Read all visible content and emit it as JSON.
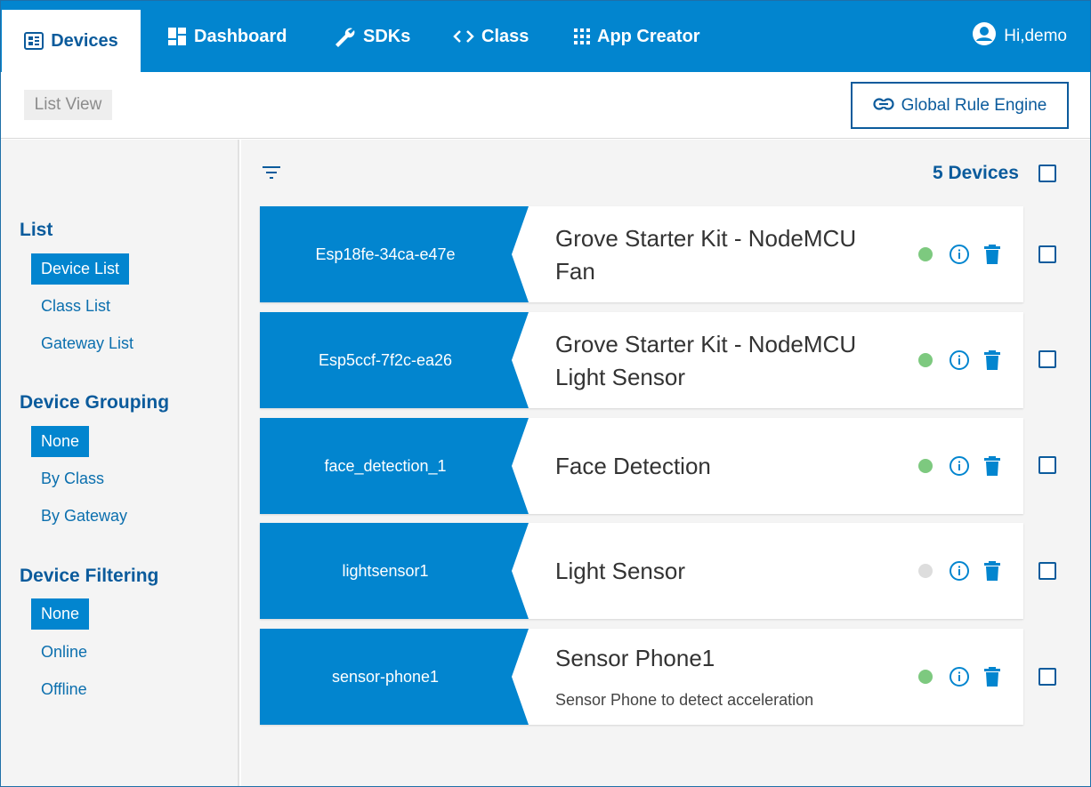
{
  "nav": {
    "active": {
      "label": "Devices",
      "icon": "devices-icon"
    },
    "items": [
      {
        "label": "Dashboard",
        "icon": "dashboard-icon"
      },
      {
        "label": "SDKs",
        "icon": "wrench-icon"
      },
      {
        "label": "Class",
        "icon": "code-icon"
      },
      {
        "label": "App Creator",
        "icon": "grid-icon"
      }
    ],
    "user": {
      "label": "Hi,demo",
      "icon": "account-circle-icon"
    }
  },
  "subheader": {
    "list_view": "List View",
    "global_rule_engine": "Global Rule Engine"
  },
  "sidebar": {
    "list": {
      "heading": "List",
      "items": [
        "Device List",
        "Class List",
        "Gateway List"
      ],
      "active": "Device List"
    },
    "grouping": {
      "heading": "Device Grouping",
      "items": [
        "None",
        "By Class",
        "By Gateway"
      ],
      "active": "None"
    },
    "filtering": {
      "heading": "Device Filtering",
      "items": [
        "None",
        "Online",
        "Offline"
      ],
      "active": "None"
    }
  },
  "main": {
    "device_count": "5 Devices",
    "devices": [
      {
        "id": "Esp18fe-34ca-e47e",
        "name_line1": "Grove Starter Kit - NodeMCU",
        "name_line2": "Fan",
        "description": "",
        "status": "online"
      },
      {
        "id": "Esp5ccf-7f2c-ea26",
        "name_line1": "Grove Starter Kit - NodeMCU",
        "name_line2": "Light Sensor",
        "description": "",
        "status": "online"
      },
      {
        "id": "face_detection_1",
        "name_line1": "Face Detection",
        "name_line2": "",
        "description": "",
        "status": "online"
      },
      {
        "id": "lightsensor1",
        "name_line1": "Light Sensor",
        "name_line2": "",
        "description": "",
        "status": "offline"
      },
      {
        "id": "sensor-phone1",
        "name_line1": "Sensor Phone1",
        "name_line2": "",
        "description": "Sensor Phone to detect acceleration",
        "status": "online"
      }
    ]
  },
  "colors": {
    "primary": "#0285cf",
    "dark_blue": "#0b5b9c",
    "online": "#7dc97f",
    "offline": "#dddddd"
  }
}
